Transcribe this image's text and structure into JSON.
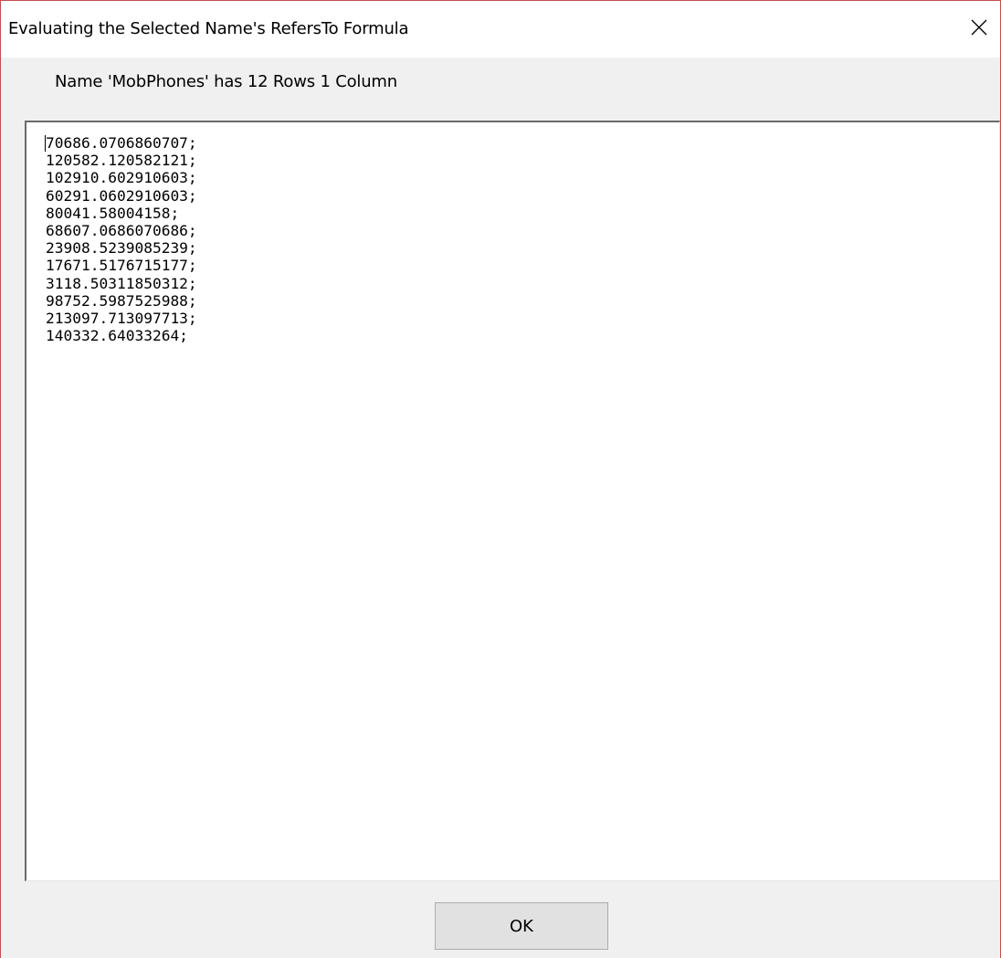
{
  "window": {
    "title": "Evaluating the Selected Name's RefersTo Formula",
    "close_icon": "close-icon",
    "accent_border_color": "#c0504d"
  },
  "dialog": {
    "summary": "Name 'MobPhones' has 12 Rows 1 Column",
    "values": [
      "70686.0706860707;",
      "120582.120582121;",
      "102910.602910603;",
      "60291.0602910603;",
      "80041.58004158;",
      "68607.0686070686;",
      "23908.5239085239;",
      "17671.5176715177;",
      "3118.50311850312;",
      "98752.5987525988;",
      "213097.713097713;",
      "140332.64033264;"
    ],
    "ok_label": "OK"
  }
}
